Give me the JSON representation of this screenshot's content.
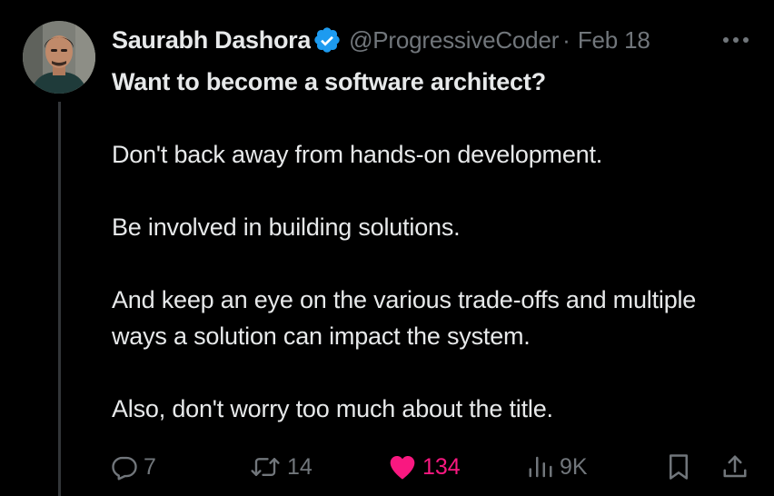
{
  "tweet": {
    "author": {
      "display_name": "Saurabh Dashora",
      "handle": "@ProgressiveCoder",
      "verified": true
    },
    "separator": "·",
    "date": "Feb 18",
    "lines": [
      "Want to become a software architect?",
      "Don't back away from hands-on development.",
      "Be involved in building solutions.",
      "And keep an eye on the various trade-offs and multiple ways a solution can impact the system.",
      "Also, don't worry too much about the title."
    ],
    "metrics": {
      "replies": "7",
      "reposts": "14",
      "likes": "134",
      "views": "9K"
    }
  },
  "colors": {
    "background": "#000000",
    "text": "#e7e9ea",
    "muted": "#71767b",
    "verified": "#1d9bf0",
    "like": "#f91880",
    "thread_line": "#333639"
  },
  "icons": {
    "more": "more-icon",
    "verified": "verified-badge-icon",
    "reply": "reply-icon",
    "repost": "repost-icon",
    "like": "heart-icon",
    "views": "views-icon",
    "bookmark": "bookmark-icon",
    "share": "share-icon"
  }
}
